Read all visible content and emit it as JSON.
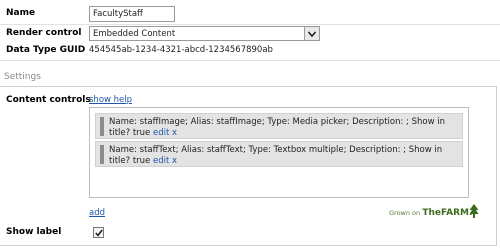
{
  "form": {
    "name_label": "Name",
    "name_value": "FacultyStaff",
    "render_label": "Render control",
    "render_value": "Embedded Content",
    "guid_label": "Data Type GUID",
    "guid_value": "454545ab-1234-4321-abcd-1234567890ab"
  },
  "settings": {
    "title": "Settings",
    "content_controls_label": "Content controls",
    "show_help": "show help",
    "properties": [
      {
        "text": "Name: staffImage; Alias: staffImage; Type: Media picker; Description: ; Show in title? true",
        "edit": "edit",
        "remove": "x"
      },
      {
        "text": "Name: staffText; Alias: staffText; Type: Textbox multiple; Description: ; Show in title? true",
        "edit": "edit",
        "remove": "x"
      }
    ],
    "add_label": "add",
    "show_label_label": "Show label",
    "show_label_checked": true
  },
  "logo": {
    "grown": "Grown on",
    "farm": "TheFARM."
  },
  "colors": {
    "link": "#2255aa",
    "logo_green": "#3d6b1e"
  }
}
